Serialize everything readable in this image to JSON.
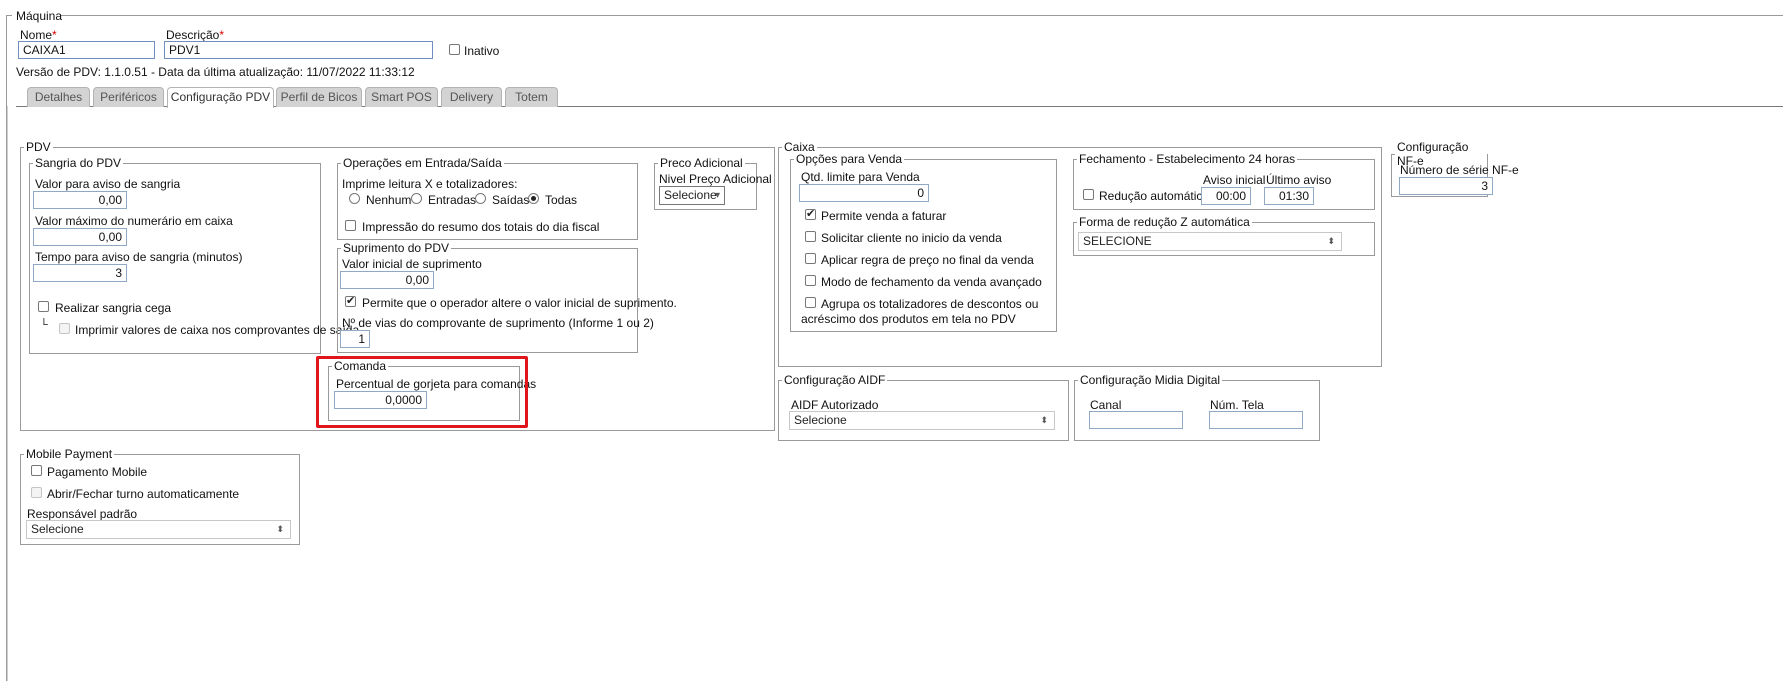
{
  "maquina": {
    "legend": "Máquina",
    "nome_label": "Nome",
    "nome_value": "CAIXA1",
    "descricao_label": "Descrição",
    "descricao_value": "PDV1",
    "required_mark": "*",
    "inativo_label": "Inativo",
    "versao_text": "Versão de PDV: 1.1.0.51 - Data da última atualização: 11/07/2022 11:33:12"
  },
  "tabs": [
    {
      "label": "Detalhes",
      "active": false
    },
    {
      "label": "Periféricos",
      "active": false
    },
    {
      "label": "Configuração PDV",
      "active": true
    },
    {
      "label": "Perfil de Bicos",
      "active": false
    },
    {
      "label": "Smart POS",
      "active": false
    },
    {
      "label": "Delivery",
      "active": false
    },
    {
      "label": "Totem",
      "active": false
    }
  ],
  "pdv": {
    "legend": "PDV",
    "sangria": {
      "legend": "Sangria do PDV",
      "aviso_label": "Valor para aviso de sangria",
      "aviso_value": "0,00",
      "maximo_label": "Valor máximo do numerário em caixa",
      "maximo_value": "0,00",
      "tempo_label": "Tempo para aviso de sangria (minutos)",
      "tempo_value": "3",
      "cega_label": "Realizar sangria cega",
      "imprimir_label": "Imprimir valores de caixa nos comprovantes de saída",
      "tree_glyph": "└"
    },
    "operacoes": {
      "legend": "Operações em Entrada/Saída",
      "imprime_label": "Imprime leitura X e totalizadores:",
      "options": [
        "Nenhum",
        "Entradas",
        "Saídas",
        "Todas"
      ],
      "selected": "Todas",
      "resumo_label": "Impressão do resumo dos totais do dia fiscal"
    },
    "preco": {
      "legend": "Preco Adicional",
      "nivel_label": "Nivel Preço Adicional",
      "select_value": "Selecione"
    },
    "suprimento": {
      "legend": "Suprimento do PDV",
      "valor_label": "Valor inicial de suprimento",
      "valor_value": "0,00",
      "permite_label": "Permite que o operador altere o valor inicial de suprimento.",
      "vias_label": "Nº de vias do comprovante de suprimento (Informe 1 ou 2)",
      "vias_value": "1"
    },
    "comanda": {
      "legend": "Comanda",
      "gorjeta_label": "Percentual de gorjeta para comandas",
      "gorjeta_value": "0,0000"
    }
  },
  "caixa": {
    "legend": "Caixa",
    "opcoes": {
      "legend": "Opções para Venda",
      "qtd_label": "Qtd. limite para Venda",
      "qtd_value": "0",
      "items": [
        {
          "label": "Permite venda a faturar",
          "checked": true
        },
        {
          "label": "Solicitar cliente no inicio da venda",
          "checked": false
        },
        {
          "label": "Aplicar regra de preço no final da venda",
          "checked": false
        },
        {
          "label": "Modo de fechamento da venda avançado",
          "checked": false
        }
      ],
      "agrupa_line1": "Agrupa os totalizadores de descontos ou",
      "agrupa_line2": "acréscimo dos produtos em tela no PDV"
    },
    "fechamento": {
      "legend": "Fechamento - Estabelecimento 24 horas",
      "reducao_label": "Redução automática",
      "aviso_inicial_label": "Aviso inicial",
      "aviso_inicial_value": "00:00",
      "ultimo_aviso_label": "Último aviso",
      "ultimo_aviso_value": "01:30"
    },
    "forma": {
      "legend": "Forma de redução Z automática",
      "select_value": "SELECIONE"
    }
  },
  "nfe": {
    "legend": "Configuração NF-e",
    "serie_label": "Número de série NF-e",
    "serie_value": "3"
  },
  "aidf": {
    "legend": "Configuração AIDF",
    "autorizado_label": "AIDF Autorizado",
    "select_value": "Selecione"
  },
  "midia": {
    "legend": "Configuração Midia Digital",
    "canal_label": "Canal",
    "canal_value": "",
    "tela_label": "Núm. Tela",
    "tela_value": ""
  },
  "mobile": {
    "legend": "Mobile Payment",
    "pagamento_label": "Pagamento Mobile",
    "abrir_label": "Abrir/Fechar turno automaticamente",
    "responsavel_label": "Responsável padrão",
    "select_value": "Selecione"
  }
}
